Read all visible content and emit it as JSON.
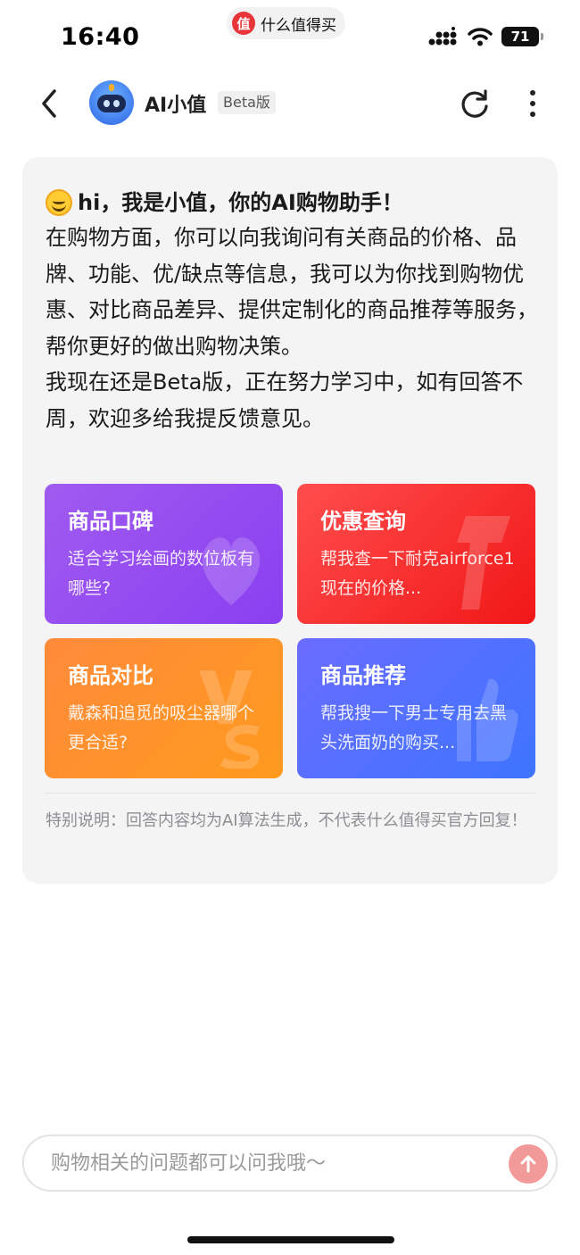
{
  "status_bar": {
    "time": "16:40",
    "app_logo_char": "值",
    "app_name": "什么值得买",
    "battery": "71"
  },
  "nav": {
    "title": "AI小值",
    "badge": "Beta版"
  },
  "message": {
    "greeting": "hi，我是小值，你的AI购物助手！",
    "paragraphs": [
      "在购物方面，你可以向我询问有关商品的价格、品牌、功能、优/缺点等信息，我可以为你找到购物优惠、对比商品差异、提供定制化的商品推荐等服务，帮你更好的做出购物决策。",
      "我现在还是Beta版，正在努力学习中，如有回答不周，欢迎多给我提反馈意见。"
    ],
    "cards": [
      {
        "title": "商品口碑",
        "desc": "适合学习绘画的数位板有哪些?"
      },
      {
        "title": "优惠查询",
        "desc": "帮我查一下耐克airforce1现在的价格..."
      },
      {
        "title": "商品对比",
        "desc": "戴森和追觅的吸尘器哪个更合适?"
      },
      {
        "title": "商品推荐",
        "desc": "帮我搜一下男士专用去黑头洗面奶的购买..."
      }
    ],
    "disclaimer": "特别说明：回答内容均为AI算法生成，不代表什么值得买官方回复！"
  },
  "input": {
    "placeholder": "购物相关的问题都可以问我哦～"
  },
  "colors": {
    "card_purple": "#9a4ff0",
    "card_red": "#f41f1f",
    "card_orange": "#ff8f2a",
    "card_blue": "#4a72ff",
    "send_button": "#f29a9a",
    "brand_red": "#e8353a"
  }
}
